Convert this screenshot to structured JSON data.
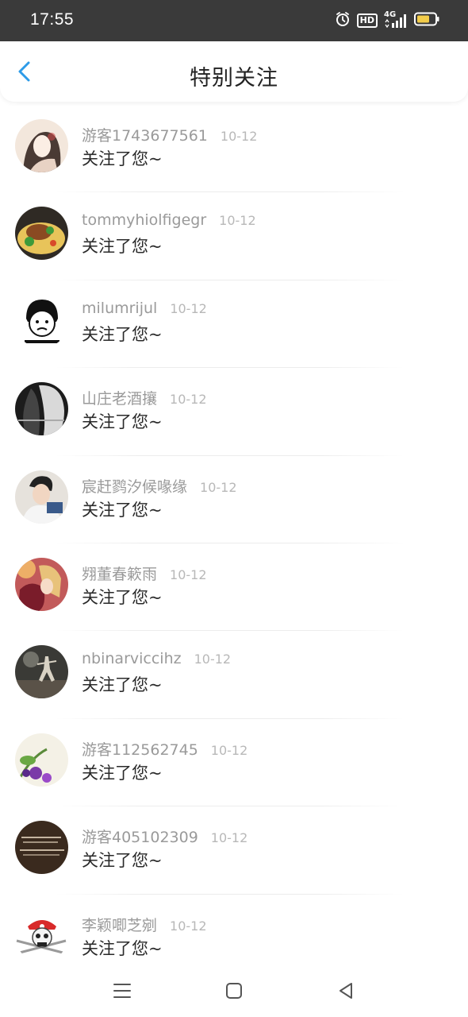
{
  "status_bar": {
    "time": "17:55",
    "network_label": "4G",
    "hd_label": "HD",
    "icons": [
      "alarm-icon",
      "hd-icon",
      "signal-icon",
      "battery-icon"
    ]
  },
  "header": {
    "title": "特别关注",
    "back_icon": "chevron-left-icon"
  },
  "colors": {
    "accent": "#2d9be8",
    "status_bar_bg": "#3a3a3a",
    "name_text": "#9a9a9a",
    "date_text": "#b8b8b8",
    "message_text": "#2a2a2a",
    "battery": "#f2cc4a"
  },
  "followers": [
    {
      "name": "游客1743677561",
      "date": "10-12",
      "message": "关注了您~"
    },
    {
      "name": "tommyhiolfigegr",
      "date": "10-12",
      "message": "关注了您~"
    },
    {
      "name": "milumrijul",
      "date": "10-12",
      "message": "关注了您~"
    },
    {
      "name": "山庄老酒攘",
      "date": "10-12",
      "message": "关注了您~"
    },
    {
      "name": "宸赶鹨汐候喙缘",
      "date": "10-12",
      "message": "关注了您~"
    },
    {
      "name": "翙董春簌雨",
      "date": "10-12",
      "message": "关注了您~"
    },
    {
      "name": "nbinarviccihz",
      "date": "10-12",
      "message": "关注了您~"
    },
    {
      "name": "游客112562745",
      "date": "10-12",
      "message": "关注了您~"
    },
    {
      "name": "游客405102309",
      "date": "10-12",
      "message": "关注了您~"
    },
    {
      "name": "李颖唧芝剜",
      "date": "10-12",
      "message": "关注了您~"
    }
  ],
  "nav_bar": {
    "icons": [
      "menu-icon",
      "home-icon",
      "back-icon"
    ]
  }
}
